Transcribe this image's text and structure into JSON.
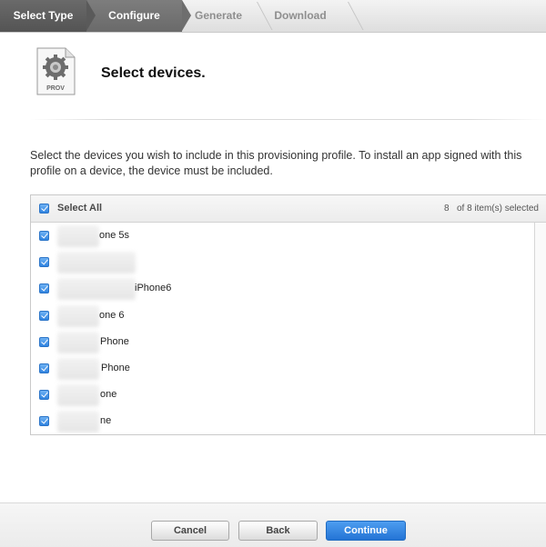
{
  "steps": [
    {
      "label": "Select Type",
      "state": "done"
    },
    {
      "label": "Configure",
      "state": "current"
    },
    {
      "label": "Generate",
      "state": "upcoming"
    },
    {
      "label": "Download",
      "state": "upcoming"
    }
  ],
  "header": {
    "icon_label": "PROV",
    "title": "Select devices."
  },
  "description": "Select the devices you wish to include in this provisioning profile. To install an app signed with this profile on a device, the device must be included.",
  "device_table": {
    "select_all_label": "Select All",
    "select_all_checked": true,
    "selected_count": "8",
    "selected_suffix": "of 8 item(s) selected",
    "rows": [
      {
        "visible_label": "one 5s",
        "checked": true
      },
      {
        "visible_label": "",
        "checked": true
      },
      {
        "visible_label": "iPhone6",
        "checked": true
      },
      {
        "visible_label": "one 6",
        "checked": true
      },
      {
        "visible_label": "Phone",
        "checked": true
      },
      {
        "visible_label": "Phone",
        "checked": true
      },
      {
        "visible_label": "one",
        "checked": true
      },
      {
        "visible_label": "ne",
        "checked": true
      }
    ]
  },
  "footer": {
    "cancel_label": "Cancel",
    "back_label": "Back",
    "continue_label": "Continue"
  },
  "colors": {
    "accent": "#2f83e0",
    "steps_done": "#5f5f5f"
  }
}
